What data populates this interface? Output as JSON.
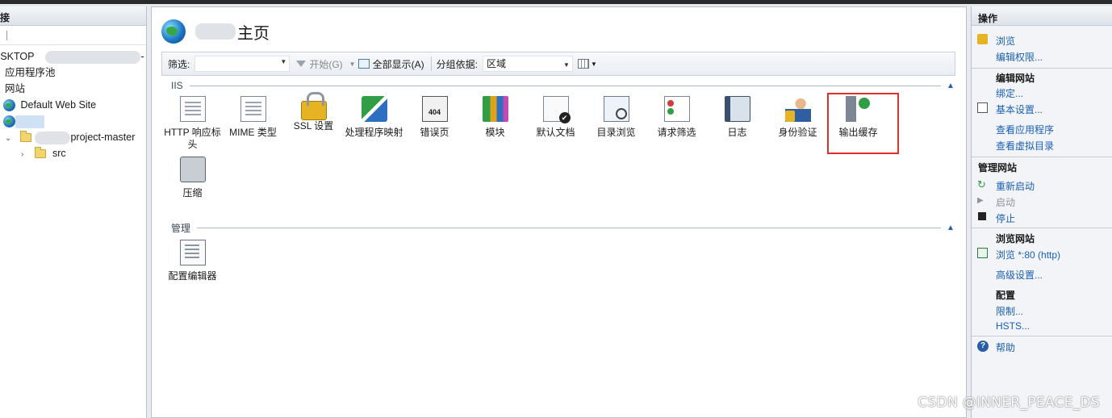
{
  "left_pane": {
    "header": "接",
    "tree": {
      "server": "ESKTOP",
      "server_suffix": "-",
      "app_pools": "应用程序池",
      "sites": "网站",
      "default_site": "Default Web Site",
      "project": "project-master",
      "src": "src"
    }
  },
  "main": {
    "title": "主页",
    "filter": {
      "label": "筛选:",
      "start": "开始(G)",
      "show_all": "全部显示(A)",
      "group_label": "分组依据:",
      "group_value": "区域"
    },
    "sections": {
      "iis": "IIS",
      "manage": "管理"
    },
    "features_iis": [
      {
        "label": "HTTP 响应标头",
        "icon": "http-response-headers-icon"
      },
      {
        "label": "MIME 类型",
        "icon": "mime-types-icon"
      },
      {
        "label": "SSL 设置",
        "icon": "ssl-settings-icon"
      },
      {
        "label": "处理程序映射",
        "icon": "handler-mappings-icon"
      },
      {
        "label": "错误页",
        "icon": "error-pages-icon"
      },
      {
        "label": "模块",
        "icon": "modules-icon"
      },
      {
        "label": "默认文档",
        "icon": "default-document-icon"
      },
      {
        "label": "目录浏览",
        "icon": "directory-browsing-icon"
      },
      {
        "label": "请求筛选",
        "icon": "request-filtering-icon"
      },
      {
        "label": "日志",
        "icon": "logging-icon"
      },
      {
        "label": "身份验证",
        "icon": "authentication-icon"
      },
      {
        "label": "输出缓存",
        "icon": "output-caching-icon"
      },
      {
        "label": "压缩",
        "icon": "compression-icon"
      }
    ],
    "features_manage": [
      {
        "label": "配置编辑器",
        "icon": "configuration-editor-icon"
      }
    ],
    "highlight_color": "#e0302a"
  },
  "right_pane": {
    "header": "操作",
    "actions_top": [
      "浏览",
      "编辑权限..."
    ],
    "edit_site_head": "编辑网站",
    "edit_site": [
      "绑定...",
      "基本设置...",
      "查看应用程序",
      "查看虚拟目录"
    ],
    "manage_site_head": "管理网站",
    "manage_site": [
      "重新启动",
      "启动",
      "停止"
    ],
    "browse_site_head": "浏览网站",
    "browse_link": "浏览 *:80 (http)",
    "advanced": "高级设置...",
    "config_head": "配置",
    "config": [
      "限制...",
      "HSTS..."
    ],
    "help": "帮助",
    "link_color": "#1a5fb4"
  },
  "watermark": "CSDN @INNER_PEACE_DS"
}
